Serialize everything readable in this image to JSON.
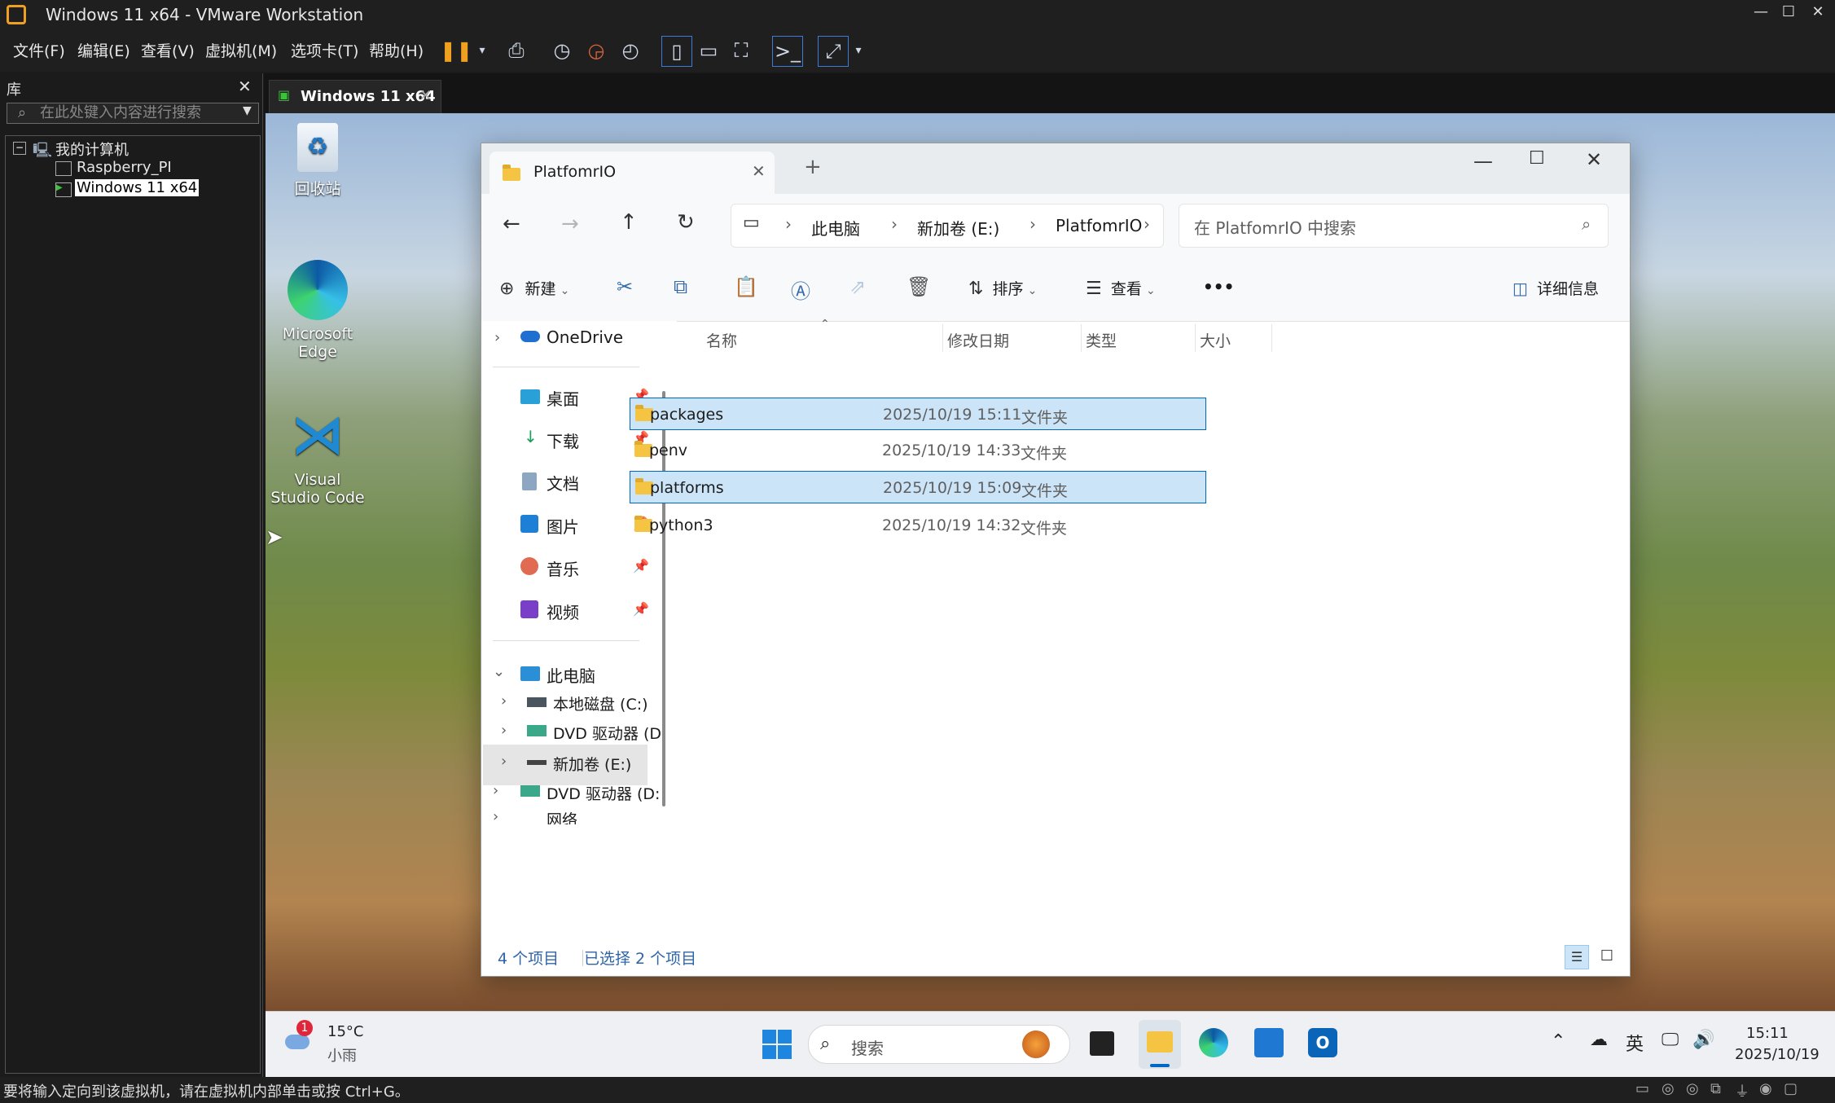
{
  "vmware": {
    "title": "Windows 11 x64 - VMware Workstation",
    "menu": [
      "文件(F)",
      "编辑(E)",
      "查看(V)",
      "虚拟机(M)",
      "选项卡(T)",
      "帮助(H)"
    ],
    "library_title": "库",
    "library_search_placeholder": "在此处键入内容进行搜索",
    "tree": {
      "root": "我的计算机",
      "items": [
        "Raspberry_PI",
        "Windows 11 x64"
      ]
    },
    "tab_label": "Windows 11 x64",
    "status_text": "要将输入定向到该虚拟机，请在虚拟机内部单击或按 Ctrl+G。"
  },
  "desktop": {
    "icons": [
      {
        "label": "回收站",
        "icon": "recycle-bin-icon"
      },
      {
        "label": "Microsoft Edge",
        "icon": "edge-icon"
      },
      {
        "label": "Visual Studio Code",
        "icon": "vscode-icon"
      }
    ]
  },
  "explorer": {
    "tab_title": "PlatfomrIO",
    "breadcrumb": [
      "此电脑",
      "新加卷 (E:)",
      "PlatfomrIO"
    ],
    "search_placeholder": "在 PlatfomrIO 中搜索",
    "commands": {
      "new": "新建",
      "sort": "排序",
      "view": "查看",
      "more": "•••",
      "details": "详细信息"
    },
    "nav": {
      "onedrive": "OneDrive",
      "quick": [
        {
          "label": "桌面",
          "icon": "desktop-icon"
        },
        {
          "label": "下载",
          "icon": "download-icon"
        },
        {
          "label": "文档",
          "icon": "document-icon"
        },
        {
          "label": "图片",
          "icon": "pictures-icon"
        },
        {
          "label": "音乐",
          "icon": "music-icon"
        },
        {
          "label": "视频",
          "icon": "video-icon"
        }
      ],
      "this_pc": "此电脑",
      "drives": [
        "本地磁盘 (C:)",
        "DVD 驱动器 (D",
        "新加卷 (E:)",
        "DVD 驱动器 (D:",
        "网络"
      ]
    },
    "columns": [
      "名称",
      "修改日期",
      "类型",
      "大小"
    ],
    "files": [
      {
        "name": "packages",
        "date": "2025/10/19 15:11",
        "type": "文件夹",
        "size": "",
        "selected": true
      },
      {
        "name": "penv",
        "date": "2025/10/19 14:33",
        "type": "文件夹",
        "size": "",
        "selected": false
      },
      {
        "name": "platforms",
        "date": "2025/10/19 15:09",
        "type": "文件夹",
        "size": "",
        "selected": true
      },
      {
        "name": "python3",
        "date": "2025/10/19 14:32",
        "type": "文件夹",
        "size": "",
        "selected": false
      }
    ],
    "status": {
      "count": "4 个项目",
      "selected": "已选择 2 个项目"
    }
  },
  "taskbar": {
    "weather_temp": "15°C",
    "weather_desc": "小雨",
    "weather_badge": "1",
    "search_label": "搜索",
    "ime": "英",
    "time": "15:11",
    "date": "2025/10/19"
  },
  "colors": {
    "accent": "#0067c0",
    "selection": "#cce4f7",
    "folder": "#f6c443",
    "vm_pause": "#f0a020"
  }
}
